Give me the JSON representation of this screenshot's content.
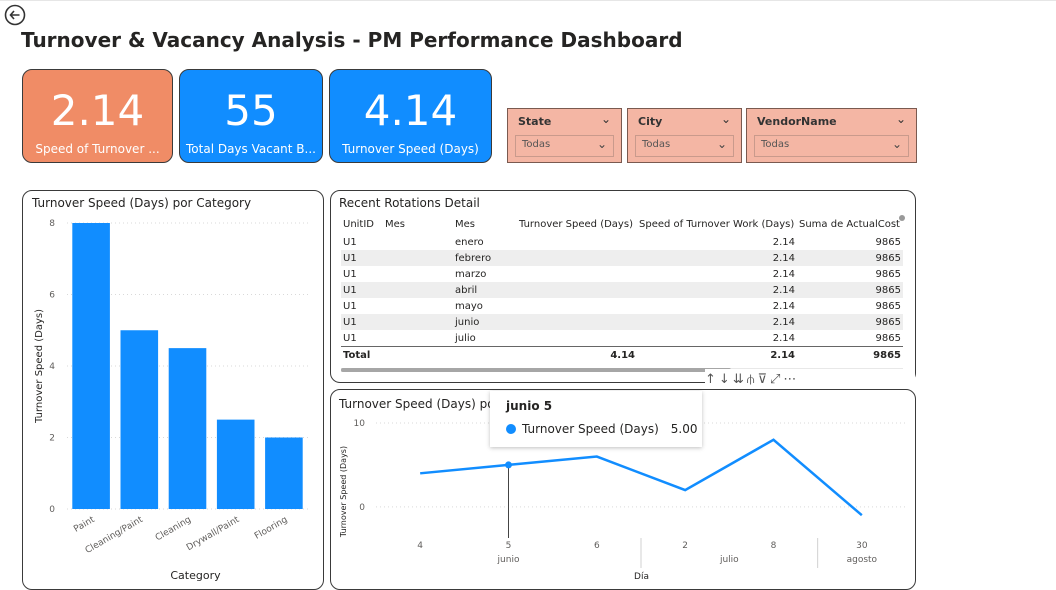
{
  "page": {
    "title": "Turnover & Vacancy Analysis - PM Performance Dashboard",
    "back_icon": "back-arrow-icon"
  },
  "kpis": [
    {
      "value": "2.14",
      "label": "Speed of Turnover ...",
      "color": "#f08c66"
    },
    {
      "value": "55",
      "label": "Total Days Vacant B...",
      "color": "#118dff"
    },
    {
      "value": "4.14",
      "label": "Turnover Speed (Days)",
      "color": "#118dff"
    }
  ],
  "slicers": [
    {
      "title": "State",
      "value": "Todas"
    },
    {
      "title": "City",
      "value": "Todas"
    },
    {
      "title": "VendorName",
      "value": "Todas"
    }
  ],
  "bar_panel": {
    "title": "Turnover Speed (Days) por Category"
  },
  "table_panel": {
    "title": "Recent Rotations Detail",
    "columns": [
      "UnitID",
      "Mes",
      "Mes",
      "Turnover Speed (Days)",
      "Speed of Turnover Work (Days)",
      "Suma de ActualCost"
    ],
    "rows": [
      [
        "U1",
        "",
        "enero",
        "",
        "2.14",
        "9865"
      ],
      [
        "U1",
        "",
        "febrero",
        "",
        "2.14",
        "9865"
      ],
      [
        "U1",
        "",
        "marzo",
        "",
        "2.14",
        "9865"
      ],
      [
        "U1",
        "",
        "abril",
        "",
        "2.14",
        "9865"
      ],
      [
        "U1",
        "",
        "mayo",
        "",
        "2.14",
        "9865"
      ],
      [
        "U1",
        "",
        "junio",
        "",
        "2.14",
        "9865"
      ],
      [
        "U1",
        "",
        "julio",
        "",
        "2.14",
        "9865"
      ]
    ],
    "total": [
      "Total",
      "",
      "",
      "4.14",
      "2.14",
      "9865"
    ]
  },
  "line_panel": {
    "title": "Turnover Speed (Days) po"
  },
  "tooltip": {
    "title": "junio 5",
    "series": "Turnover Speed (Days)",
    "value": "5.00"
  },
  "visual_header": {
    "icons": [
      "move-up-icon",
      "drill-down-icon",
      "expand-all-icon",
      "expand-next-level-icon",
      "filter-icon",
      "focus-mode-icon",
      "more-options-icon"
    ],
    "glyphs": [
      "↑",
      "↓",
      "⇊",
      "⫛",
      "⊽",
      "⤢",
      "⋯"
    ]
  },
  "colors": {
    "accent": "#118dff",
    "orange_kpi": "#f08c66",
    "slicer_bg": "#f4b6a4"
  },
  "chart_data": [
    {
      "type": "bar",
      "title": "Turnover Speed (Days) por Category",
      "xlabel": "Category",
      "ylabel": "Turnover Speed (Days)",
      "categories": [
        "Paint",
        "Cleaning/Paint",
        "Cleaning",
        "Drywall/Paint",
        "Flooring"
      ],
      "values": [
        8,
        5,
        4.5,
        2.5,
        2
      ],
      "ylim": [
        0,
        8
      ],
      "yticks": [
        0,
        2,
        4,
        6,
        8
      ],
      "grid": true,
      "color": "#118dff"
    },
    {
      "type": "line",
      "title": "Turnover Speed (Days) po",
      "xlabel": "Día",
      "ylabel": "Turnover Speed (Days)",
      "x": [
        "4",
        "5",
        "6",
        "2",
        "8",
        "30"
      ],
      "groups": [
        {
          "label": "junio",
          "days": [
            "4",
            "5",
            "6"
          ]
        },
        {
          "label": "julio",
          "days": [
            "2",
            "8"
          ]
        },
        {
          "label": "agosto",
          "days": [
            "30"
          ]
        }
      ],
      "series": [
        {
          "name": "Turnover Speed (Days)",
          "values": [
            4,
            5,
            6,
            2,
            8,
            -1
          ]
        }
      ],
      "ylim": [
        -3,
        10
      ],
      "yticks": [
        0,
        10
      ],
      "highlight_index": 1,
      "grid": true,
      "color": "#118dff"
    }
  ]
}
